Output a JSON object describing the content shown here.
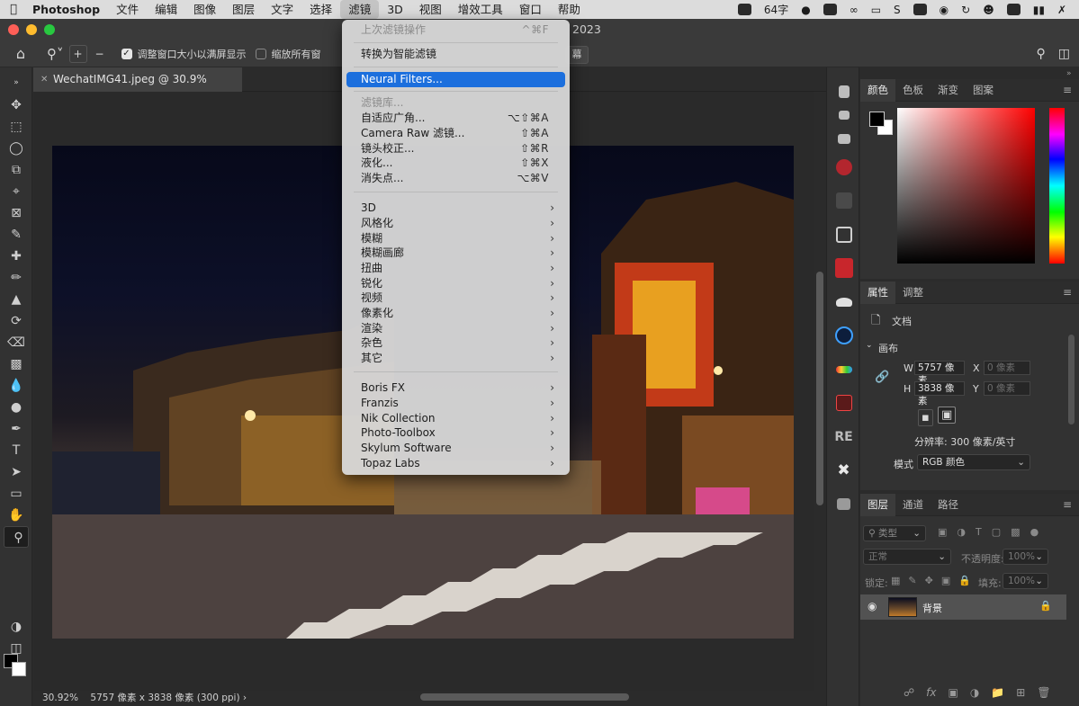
{
  "menubar": {
    "app": "Photoshop",
    "items": [
      "文件",
      "编辑",
      "图像",
      "图层",
      "文字",
      "选择",
      "滤镜",
      "3D",
      "视图",
      "增效工具",
      "窗口",
      "帮助"
    ],
    "active": "滤镜",
    "status_text": "64字"
  },
  "window": {
    "title_fragment": "2023"
  },
  "options_bar": {
    "fit_window_label": "调整窗口大小以满屏显示",
    "zoom_all_label": "缩放所有窗",
    "fill_screen_fragment": "幕"
  },
  "document": {
    "tab_title": "WechatIMG41.jpeg @ 30.9%(RGB/16)",
    "status_zoom": "30.92%",
    "status_info": "5757 像素 x 3838 像素 (300 ppi)"
  },
  "filter_menu": {
    "last_filter": "上次滤镜操作",
    "last_filter_shortcut": "^⌘F",
    "smart": "转换为智能滤镜",
    "neural": "Neural Filters...",
    "gallery": "滤镜库...",
    "adaptive": "自适应广角...",
    "adaptive_shortcut": "⌥⇧⌘A",
    "camera_raw": "Camera Raw 滤镜...",
    "camera_raw_shortcut": "⇧⌘A",
    "lens": "镜头校正...",
    "lens_shortcut": "⇧⌘R",
    "liquify": "液化...",
    "liquify_shortcut": "⇧⌘X",
    "vanishing": "消失点...",
    "vanishing_shortcut": "⌥⌘V",
    "submenus": [
      "3D",
      "风格化",
      "模糊",
      "模糊画廊",
      "扭曲",
      "锐化",
      "视频",
      "像素化",
      "渲染",
      "杂色",
      "其它"
    ],
    "plugins": [
      "Boris FX",
      "Franzis",
      "Nik Collection",
      "Photo-Toolbox",
      "Skylum Software",
      "Topaz Labs"
    ]
  },
  "color_panel": {
    "tabs": [
      "颜色",
      "色板",
      "渐变",
      "图案"
    ]
  },
  "properties_panel": {
    "tabs": [
      "属性",
      "调整"
    ],
    "doc_label": "文档",
    "canvas_label": "画布",
    "w_label": "W",
    "w_value": "5757 像素",
    "h_label": "H",
    "h_value": "3838 像素",
    "x_label": "X",
    "x_placeholder": "0 像素",
    "y_label": "Y",
    "y_placeholder": "0 像素",
    "resolution": "分辨率: 300 像素/英寸",
    "mode_label": "模式",
    "mode_value": "RGB 颜色"
  },
  "layers_panel": {
    "tabs": [
      "图层",
      "通道",
      "路径"
    ],
    "filter_type": "类型",
    "blend_mode": "正常",
    "opacity_label": "不透明度:",
    "opacity_value": "100%",
    "lock_label": "锁定:",
    "fill_label": "填充:",
    "fill_value": "100%",
    "layer_name": "背景"
  },
  "colors": {
    "accent": "#1c6fdd",
    "menubar_bg": "#dcdcdc",
    "panel_bg": "#323232",
    "traffic_red": "#fe5f57",
    "traffic_yellow": "#febc2e",
    "traffic_green": "#28c840"
  }
}
